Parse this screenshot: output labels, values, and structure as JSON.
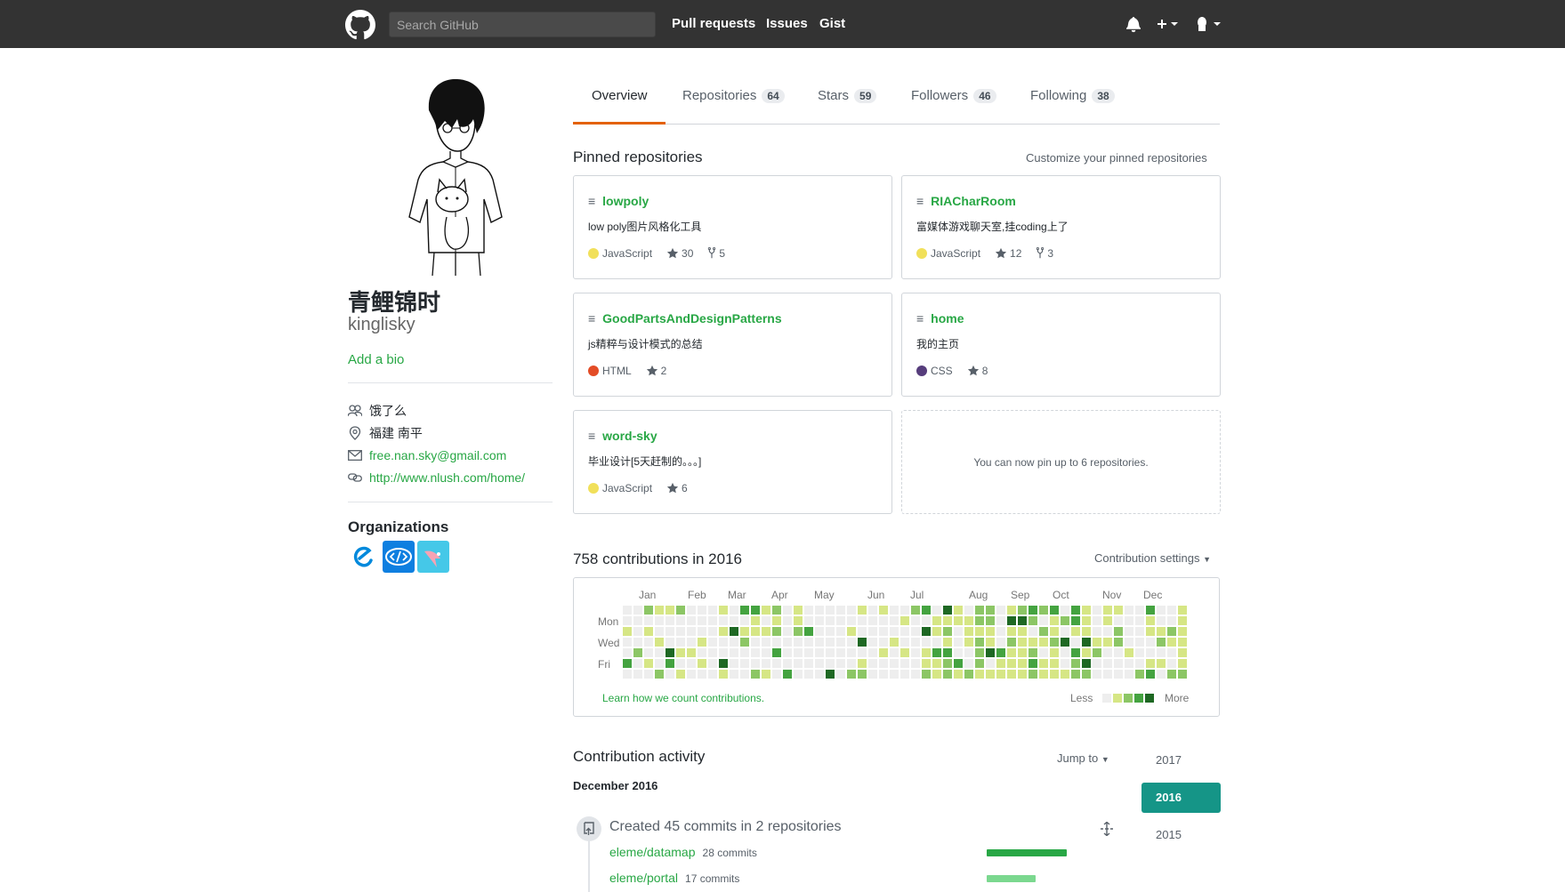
{
  "header": {
    "search_placeholder": "Search GitHub",
    "nav": [
      "Pull requests",
      "Issues",
      "Gist"
    ]
  },
  "profile": {
    "fullname": "青鲤锦时",
    "username": "kinglisky",
    "add_bio": "Add a bio",
    "company": "饿了么",
    "location": "福建 南平",
    "email": "free.nan.sky@gmail.com",
    "website": "http://www.nlush.com/home/",
    "organizations_title": "Organizations"
  },
  "tabs": [
    {
      "label": "Overview",
      "count": ""
    },
    {
      "label": "Repositories",
      "count": "64"
    },
    {
      "label": "Stars",
      "count": "59"
    },
    {
      "label": "Followers",
      "count": "46"
    },
    {
      "label": "Following",
      "count": "38"
    }
  ],
  "pinned": {
    "title": "Pinned repositories",
    "customize": "Customize your pinned repositories",
    "empty_note": "You can now pin up to 6 repositories.",
    "repos": [
      {
        "name": "lowpoly",
        "desc": "low poly图片风格化工具",
        "lang": "JavaScript",
        "lang_color": "#f1e05a",
        "stars": "30",
        "forks": "5"
      },
      {
        "name": "RIACharRoom",
        "desc": "富媒体游戏聊天室,挂coding上了",
        "lang": "JavaScript",
        "lang_color": "#f1e05a",
        "stars": "12",
        "forks": "3"
      },
      {
        "name": "GoodPartsAndDesignPatterns",
        "desc": "js精粹与设计模式的总结",
        "lang": "HTML",
        "lang_color": "#e34c26",
        "stars": "2",
        "forks": ""
      },
      {
        "name": "home",
        "desc": "我的主页",
        "lang": "CSS",
        "lang_color": "#563d7c",
        "stars": "8",
        "forks": ""
      },
      {
        "name": "word-sky",
        "desc": "毕业设计[5天赶制的。。。]",
        "lang": "JavaScript",
        "lang_color": "#f1e05a",
        "stars": "6",
        "forks": ""
      }
    ]
  },
  "contributions": {
    "title": "758 contributions in 2016",
    "settings": "Contribution settings",
    "months": [
      "Jan",
      "Feb",
      "Mar",
      "Apr",
      "May",
      "Jun",
      "Jul",
      "Aug",
      "Sep",
      "Oct",
      "Nov",
      "Dec"
    ],
    "days": [
      "Mon",
      "Wed",
      "Fri"
    ],
    "learn": "Learn how we count contributions.",
    "less": "Less",
    "more": "More",
    "colors": [
      "#eeeeee",
      "#d6e685",
      "#8cc665",
      "#44a340",
      "#1e6823"
    ]
  },
  "activity": {
    "title": "Contribution activity",
    "jump": "Jump to",
    "years": [
      "2017",
      "2016",
      "2015"
    ],
    "month": "December 2016",
    "event": "Created 45 commits in 2 repositories",
    "repos": [
      {
        "name": "eleme/datamap",
        "count": "28 commits",
        "fraction": 1.0,
        "color": "#28a745"
      },
      {
        "name": "eleme/portal",
        "count": "17 commits",
        "fraction": 0.607,
        "color": "#7bd88f"
      }
    ]
  }
}
